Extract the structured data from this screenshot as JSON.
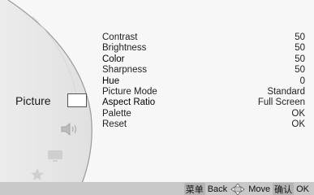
{
  "category": {
    "label": "Picture",
    "icons": [
      "picture-icon",
      "sound-icon",
      "tv-icon",
      "star-icon"
    ]
  },
  "menu": {
    "items": [
      {
        "label": "Contrast",
        "value": "50"
      },
      {
        "label": "Brightness",
        "value": "50"
      },
      {
        "label": "Color",
        "value": "50"
      },
      {
        "label": "Sharpness",
        "value": "50"
      },
      {
        "label": "Hue",
        "value": "0"
      },
      {
        "label": "Picture Mode",
        "value": "Standard"
      },
      {
        "label": "Aspect Ratio",
        "value": "Full Screen"
      },
      {
        "label": "Palette",
        "value": "OK"
      },
      {
        "label": "Reset",
        "value": "OK"
      }
    ]
  },
  "footer": {
    "back_key": "菜单",
    "back_label": "Back",
    "move_label": "Move",
    "ok_key": "确认",
    "ok_label": "OK"
  },
  "colors": {
    "background": "#f7f7f7",
    "footer": "#c8c8c8",
    "panel_curve": "#9a9a9a"
  }
}
